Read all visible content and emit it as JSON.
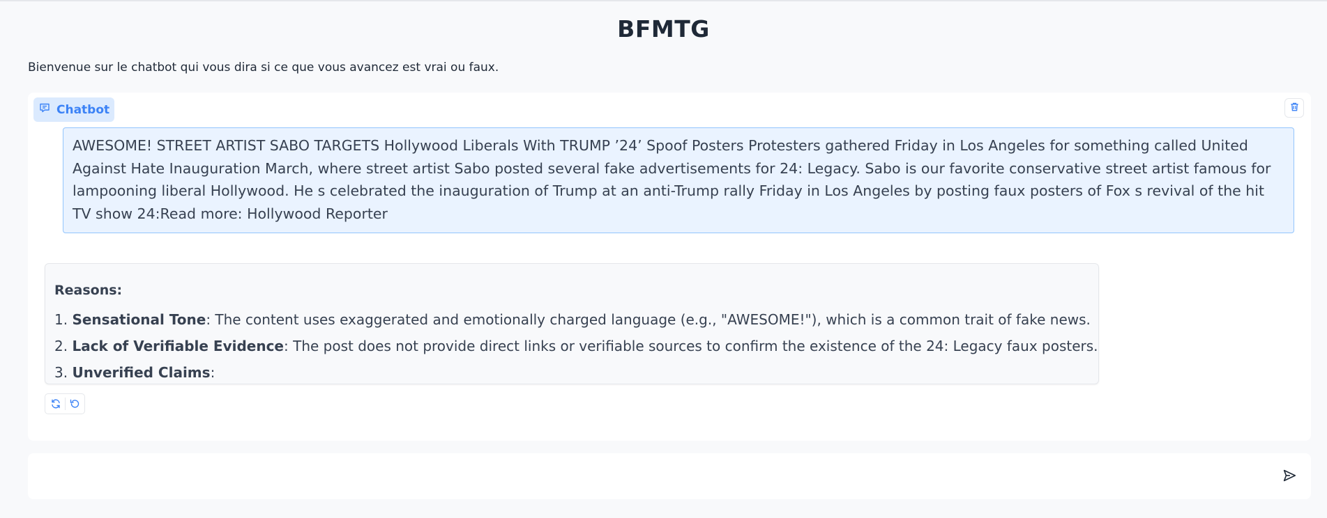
{
  "app": {
    "title": "BFMTG",
    "subtitle": "Bienvenue sur le chatbot qui vous dira si ce que vous avancez est vrai ou faux."
  },
  "chatbot": {
    "label": "Chatbot",
    "label_icon": "chat-icon",
    "clear_icon": "trash-icon",
    "messages": {
      "user": "AWESOME! STREET ARTIST SABO TARGETS Hollywood Liberals With TRUMP ’24’ Spoof Posters Protesters gathered Friday in Los Angeles for something called United Against Hate Inauguration March, where street artist Sabo posted several fake advertisements for 24: Legacy. Sabo is our favorite conservative street artist famous for lampooning liberal Hollywood. He s celebrated the inauguration of Trump at an anti-Trump rally Friday in Los Angeles by posting faux posters of Fox s revival of the hit TV show 24:Read more: Hollywood Reporter",
      "bot": {
        "heading": "Reasons:",
        "items": [
          {
            "num": "1.",
            "term": "Sensational Tone",
            "text": ": The content uses exaggerated and emotionally charged language (e.g., \"AWESOME!\"), which is a common trait of fake news."
          },
          {
            "num": "2.",
            "term": "Lack of Verifiable Evidence",
            "text": ": The post does not provide direct links or verifiable sources to confirm the existence of the 24: Legacy faux posters."
          },
          {
            "num": "3.",
            "term": "Unverified Claims",
            "text": ":"
          }
        ]
      }
    },
    "actions": {
      "retry_icon": "refresh-icon",
      "undo_icon": "undo-icon"
    }
  },
  "input": {
    "value": "",
    "placeholder": "",
    "send_icon": "send-icon"
  },
  "colors": {
    "accent": "#3b82f6",
    "user_bubble_bg": "#eaf3ff",
    "user_bubble_border": "#93c5fd",
    "page_bg": "#f8f9fb"
  }
}
